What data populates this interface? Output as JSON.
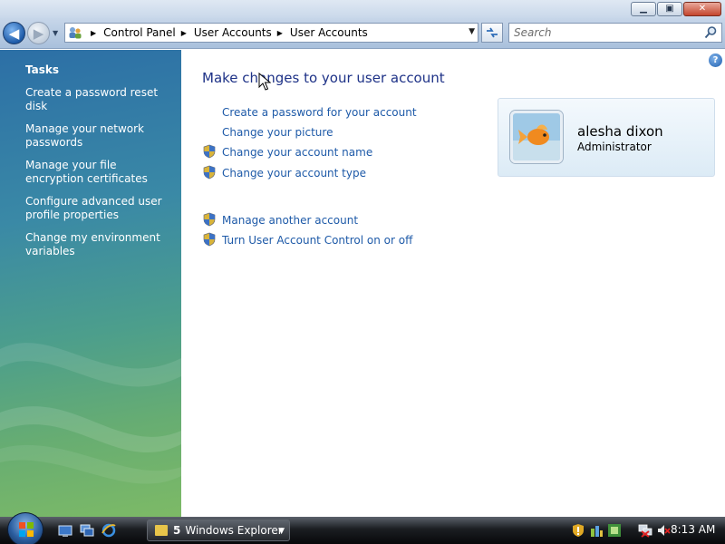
{
  "window": {
    "minimize_glyph": "▁",
    "maximize_glyph": "▣",
    "close_glyph": "✕"
  },
  "nav": {
    "back_glyph": "◀",
    "forward_glyph": "▶",
    "dropdown_glyph": "▼",
    "breadcrumbs": [
      "Control Panel",
      "User Accounts",
      "User Accounts"
    ],
    "search_placeholder": "Search",
    "refresh_icon": "refresh-icon"
  },
  "sidebar": {
    "title": "Tasks",
    "items": [
      {
        "label": "Create a password reset disk"
      },
      {
        "label": "Manage your network passwords"
      },
      {
        "label": "Manage your file encryption certificates"
      },
      {
        "label": "Configure advanced user profile properties"
      },
      {
        "label": "Change my environment variables"
      }
    ]
  },
  "main": {
    "help_glyph": "?",
    "title": "Make changes to your user account",
    "links": [
      {
        "label": "Create a password for your account",
        "shield": false
      },
      {
        "label": "Change your picture",
        "shield": false
      },
      {
        "label": "Change your account name",
        "shield": true
      },
      {
        "label": "Change your account type",
        "shield": true
      }
    ],
    "other_links": [
      {
        "label": "Manage another account",
        "shield": true
      },
      {
        "label": "Turn User Account Control on or off",
        "shield": true
      }
    ]
  },
  "user": {
    "name": "alesha dixon",
    "role": "Administrator",
    "picture": "goldfish-picture"
  },
  "taskbar": {
    "window_count": "5",
    "window_label": "Windows Explorer",
    "time": "8:13 AM"
  },
  "colors": {
    "link": "#1e5aa8",
    "title": "#1e3287"
  }
}
